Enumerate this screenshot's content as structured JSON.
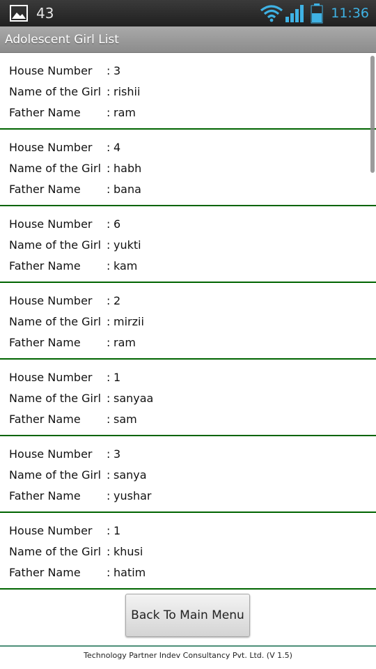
{
  "status_bar": {
    "notification_count": "43",
    "time": "11:36",
    "icons": [
      "gallery-icon",
      "wifi-icon",
      "signal-icon",
      "battery-icon"
    ]
  },
  "header": {
    "title": "Adolescent Girl List"
  },
  "labels": {
    "house_number": "House Number",
    "girl_name": "Name of the Girl",
    "father_name": "Father Name",
    "separator": ":"
  },
  "girls": [
    {
      "house_number": "3",
      "girl_name": "rishii",
      "father_name": "ram"
    },
    {
      "house_number": "4",
      "girl_name": "habh",
      "father_name": "bana"
    },
    {
      "house_number": "6",
      "girl_name": "yukti",
      "father_name": "kam"
    },
    {
      "house_number": "2",
      "girl_name": "mirzii",
      "father_name": "ram"
    },
    {
      "house_number": "1",
      "girl_name": "sanyaa",
      "father_name": "sam"
    },
    {
      "house_number": "3",
      "girl_name": "sanya",
      "father_name": "yushar"
    },
    {
      "house_number": "1",
      "girl_name": "khusi",
      "father_name": "hatim"
    }
  ],
  "actions": {
    "back_label": "Back To Main Menu"
  },
  "footer": {
    "text": "Technology Partner Indev Consultancy Pvt. Ltd. (V 1.5)"
  },
  "colors": {
    "divider": "#006400",
    "status_time": "#3fb2e4",
    "title_bar": "#999999",
    "footer_line": "#4c8f78"
  }
}
